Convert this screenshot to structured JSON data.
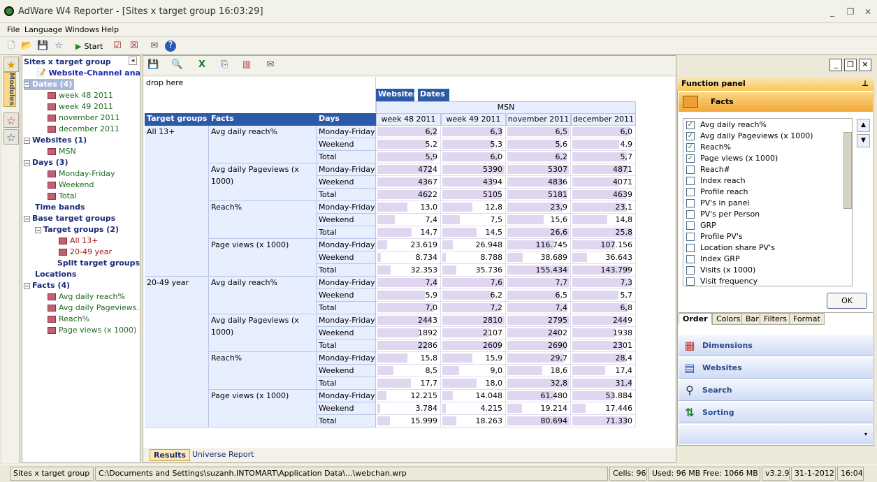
{
  "window": {
    "title": "AdWare W4 Reporter - [Sites x target group 16:03:29]"
  },
  "menu": [
    "File",
    "Language",
    "Windows",
    "Help"
  ],
  "toolbar": {
    "start_label": "Start"
  },
  "modules_label": "Modules",
  "tree": {
    "root": "Sites x target group",
    "analysis": "Website-Channel ana...",
    "dates": "Dates (4)",
    "date_items": [
      "week 48 2011",
      "week 49 2011",
      "november 2011",
      "december 2011"
    ],
    "websites": "Websites (1)",
    "website_items": [
      "MSN"
    ],
    "days": "Days (3)",
    "day_items": [
      "Monday-Friday",
      "Weekend",
      "Total"
    ],
    "timebands": "Time bands",
    "base": "Base target groups",
    "targetgroups": "Target groups (2)",
    "tg_items": [
      "All 13+",
      "20-49  year"
    ],
    "split": "Split target groups",
    "locations": "Locations",
    "facts": "Facts (4)",
    "fact_items": [
      "Avg daily reach%",
      "Avg daily Pageviews...",
      "Reach%",
      "Page views (x 1000)"
    ]
  },
  "grid": {
    "drop_here": "drop here",
    "col_fields": [
      "Websites",
      "Dates"
    ],
    "site": "MSN",
    "row_headers": [
      "Target groups",
      "Facts",
      "Days"
    ],
    "columns": [
      "week 48 2011",
      "week 49 2011",
      "november 2011",
      "december 2011"
    ],
    "groups": [
      {
        "name": "All 13+",
        "facts": [
          {
            "name": "Avg daily reach%",
            "rows": [
              [
                "Monday-Friday",
                [
                  "6,2",
                  "6,3",
                  "6,5",
                  "6,0"
                ]
              ],
              [
                "Weekend",
                [
                  "5,2",
                  "5,3",
                  "5,6",
                  "4,9"
                ]
              ],
              [
                "Total",
                [
                  "5,9",
                  "6,0",
                  "6,2",
                  "5,7"
                ]
              ]
            ]
          },
          {
            "name": "Avg daily Pageviews (x 1000)",
            "rows": [
              [
                "Monday-Friday",
                [
                  "4724",
                  "5390",
                  "5307",
                  "4871"
                ]
              ],
              [
                "Weekend",
                [
                  "4367",
                  "4394",
                  "4836",
                  "4071"
                ]
              ],
              [
                "Total",
                [
                  "4622",
                  "5105",
                  "5181",
                  "4639"
                ]
              ]
            ]
          },
          {
            "name": "Reach%",
            "rows": [
              [
                "Monday-Friday",
                [
                  "13,0",
                  "12,8",
                  "23,9",
                  "23,1"
                ]
              ],
              [
                "Weekend",
                [
                  "7,4",
                  "7,5",
                  "15,6",
                  "14,8"
                ]
              ],
              [
                "Total",
                [
                  "14,7",
                  "14,5",
                  "26,6",
                  "25,8"
                ]
              ]
            ]
          },
          {
            "name": "Page views (x 1000)",
            "rows": [
              [
                "Monday-Friday",
                [
                  "23.619",
                  "26.948",
                  "116.745",
                  "107.156"
                ]
              ],
              [
                "Weekend",
                [
                  "8.734",
                  "8.788",
                  "38.689",
                  "36.643"
                ]
              ],
              [
                "Total",
                [
                  "32.353",
                  "35.736",
                  "155.434",
                  "143.799"
                ]
              ]
            ]
          }
        ]
      },
      {
        "name": "20-49  year",
        "facts": [
          {
            "name": "Avg daily reach%",
            "rows": [
              [
                "Monday-Friday",
                [
                  "7,4",
                  "7,6",
                  "7,7",
                  "7,3"
                ]
              ],
              [
                "Weekend",
                [
                  "5,9",
                  "6,2",
                  "6,5",
                  "5,7"
                ]
              ],
              [
                "Total",
                [
                  "7,0",
                  "7,2",
                  "7,4",
                  "6,8"
                ]
              ]
            ]
          },
          {
            "name": "Avg daily Pageviews (x 1000)",
            "rows": [
              [
                "Monday-Friday",
                [
                  "2443",
                  "2810",
                  "2795",
                  "2449"
                ]
              ],
              [
                "Weekend",
                [
                  "1892",
                  "2107",
                  "2402",
                  "1938"
                ]
              ],
              [
                "Total",
                [
                  "2286",
                  "2609",
                  "2690",
                  "2301"
                ]
              ]
            ]
          },
          {
            "name": "Reach%",
            "rows": [
              [
                "Monday-Friday",
                [
                  "15,8",
                  "15,9",
                  "29,7",
                  "28,4"
                ]
              ],
              [
                "Weekend",
                [
                  "8,5",
                  "9,0",
                  "18,6",
                  "17,4"
                ]
              ],
              [
                "Total",
                [
                  "17,7",
                  "18,0",
                  "32,8",
                  "31,4"
                ]
              ]
            ]
          },
          {
            "name": "Page views (x 1000)",
            "rows": [
              [
                "Monday-Friday",
                [
                  "12.215",
                  "14.048",
                  "61.480",
                  "53.884"
                ]
              ],
              [
                "Weekend",
                [
                  "3.784",
                  "4.215",
                  "19.214",
                  "17.446"
                ]
              ],
              [
                "Total",
                [
                  "15.999",
                  "18.263",
                  "80.694",
                  "71.330"
                ]
              ]
            ]
          }
        ]
      }
    ]
  },
  "bottom_tabs": [
    "Results",
    "Universe",
    "Report"
  ],
  "function_panel": {
    "title": "Function panel",
    "facts_tab": "Facts",
    "facts": [
      {
        "label": "Avg daily reach%",
        "checked": true
      },
      {
        "label": "Avg daily Pageviews (x 1000)",
        "checked": true
      },
      {
        "label": "Reach%",
        "checked": true
      },
      {
        "label": "Page views (x 1000)",
        "checked": true
      },
      {
        "label": "Reach#",
        "checked": false
      },
      {
        "label": "Index reach",
        "checked": false
      },
      {
        "label": "Profile reach",
        "checked": false
      },
      {
        "label": "PV's in panel",
        "checked": false
      },
      {
        "label": "PV's per Person",
        "checked": false
      },
      {
        "label": "GRP",
        "checked": false
      },
      {
        "label": "Profile PV's",
        "checked": false
      },
      {
        "label": "Location share PV's",
        "checked": false
      },
      {
        "label": "Index GRP",
        "checked": false
      },
      {
        "label": "Visits (x 1000)",
        "checked": false
      },
      {
        "label": "Visit frequency",
        "checked": false
      }
    ],
    "ok": "OK",
    "subtabs": [
      "Order",
      "Colors",
      "Bar",
      "Filters",
      "Format"
    ],
    "nav": [
      "Dimensions",
      "Websites",
      "Search",
      "Sorting"
    ]
  },
  "status": {
    "name": "Sites x target group",
    "path": "C:\\Documents and Settings\\suzanh.INTOMART\\Application Data\\...\\webchan.wrp",
    "cells": "Cells: 96",
    "memory": "Used: 96 MB Free: 1066 MB",
    "version": "v3.2.9",
    "date": "31-1-2012",
    "time": "16:04"
  }
}
